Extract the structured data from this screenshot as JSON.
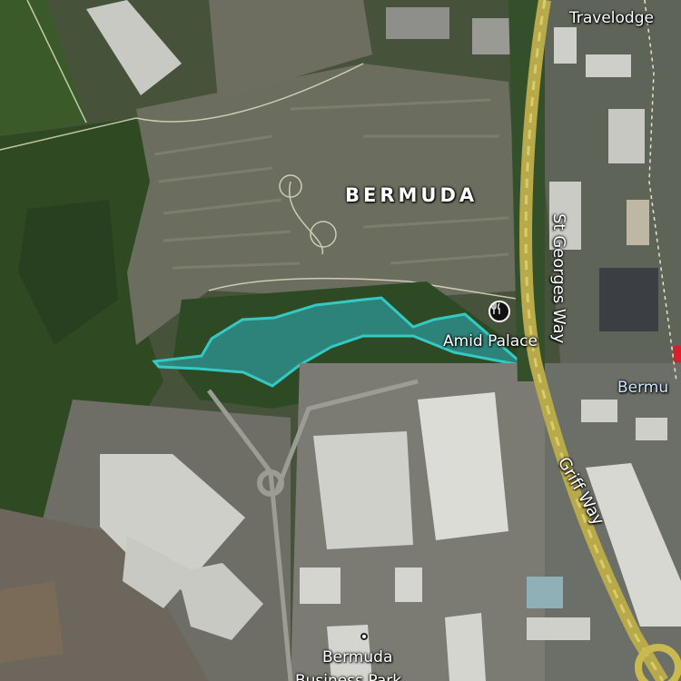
{
  "map": {
    "type": "satellite",
    "highlight_color": "#35c9c3",
    "labels": {
      "area": "BERMUDA",
      "travelodge": "Travelodge",
      "st_georges_way": "St Georges Way",
      "amid_palace": "Amid Palace",
      "bermu": "Bermu",
      "griff_way": "Griff Way",
      "bermuda_business": "Bermuda",
      "business_park": "Business Park"
    },
    "icons": {
      "restaurant": "fork-knife-icon",
      "poi_dot": "location-dot-icon"
    }
  }
}
